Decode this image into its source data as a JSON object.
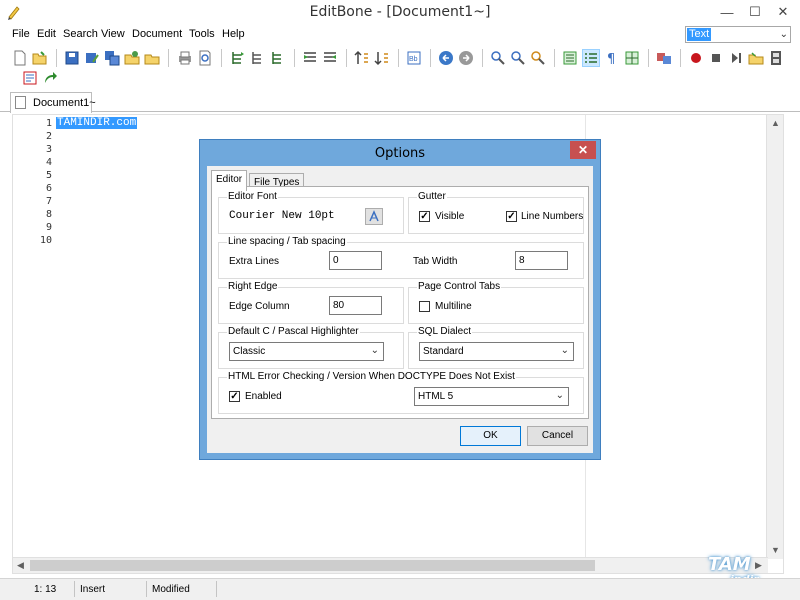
{
  "window": {
    "title": "EditBone - [Document1~]"
  },
  "menu": [
    "File",
    "Edit",
    "Search",
    "View",
    "Document",
    "Tools",
    "Help"
  ],
  "highlighter_select": {
    "value": "Text"
  },
  "tabs": [
    {
      "label": "Document1~"
    }
  ],
  "editor": {
    "line_numbers": [
      "1",
      "2",
      "3",
      "4",
      "5",
      "6",
      "7",
      "8",
      "9",
      "10"
    ],
    "first_line_text": "TAMİNDİR.com"
  },
  "status": {
    "position": "1: 13",
    "mode": "Insert",
    "state": "Modified"
  },
  "watermark": {
    "line1": "TAM",
    "line2": "indir"
  },
  "dialog": {
    "title": "Options",
    "close_glyph": "✕",
    "tabs": [
      "Editor",
      "File Types"
    ],
    "editor_font": {
      "caption": "Editor Font",
      "sample": "Courier New 10pt"
    },
    "gutter": {
      "caption": "Gutter",
      "visible_label": "Visible",
      "visible_checked": true,
      "line_numbers_label": "Line Numbers",
      "line_numbers_checked": true
    },
    "spacing": {
      "caption": "Line spacing / Tab spacing",
      "extra_lines_label": "Extra Lines",
      "extra_lines_value": "0",
      "tab_width_label": "Tab Width",
      "tab_width_value": "8"
    },
    "right_edge": {
      "caption": "Right Edge",
      "edge_column_label": "Edge Column",
      "edge_column_value": "80"
    },
    "page_tabs": {
      "caption": "Page Control Tabs",
      "multiline_label": "Multiline",
      "multiline_checked": false
    },
    "pascal": {
      "caption": "Default C / Pascal Highlighter",
      "value": "Classic"
    },
    "sql": {
      "caption": "SQL Dialect",
      "value": "Standard"
    },
    "html": {
      "caption": "HTML Error Checking / Version When DOCTYPE Does Not Exist",
      "enabled_label": "Enabled",
      "enabled_checked": true,
      "version_value": "HTML 5"
    },
    "ok_label": "OK",
    "cancel_label": "Cancel",
    "check_glyph": "✓"
  }
}
